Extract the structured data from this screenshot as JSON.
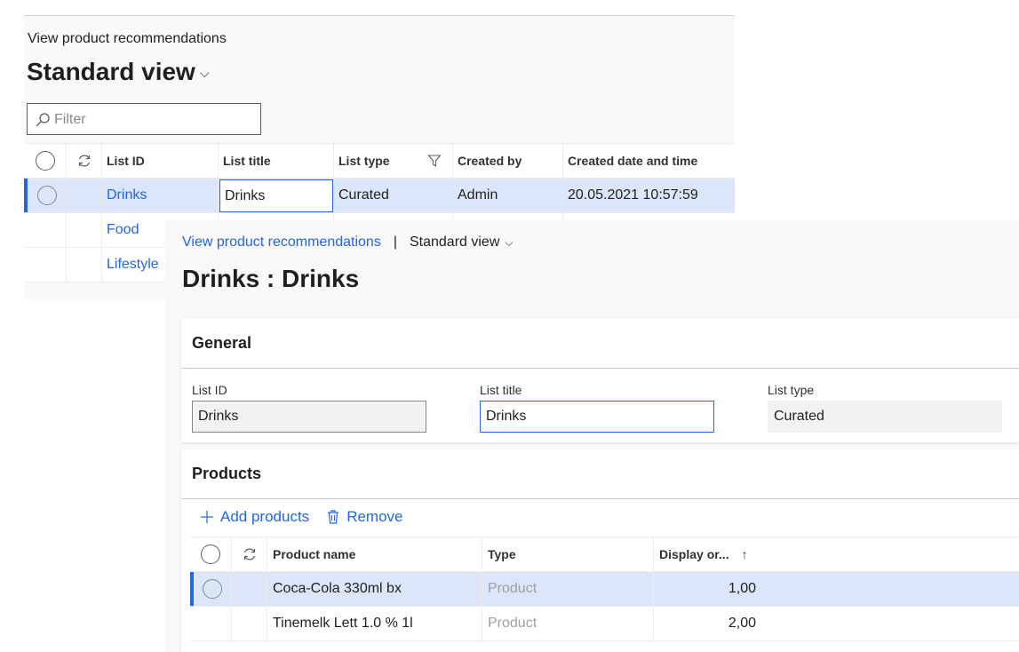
{
  "list_page": {
    "caption": "View product recommendations",
    "view_title": "Standard view",
    "filter_placeholder": "Filter",
    "columns": [
      "List ID",
      "List title",
      "List type",
      "Created by",
      "Created date and time"
    ],
    "rows": [
      {
        "id": "Drinks",
        "title": "Drinks",
        "type": "Curated",
        "created_by": "Admin",
        "created_at": "20.05.2021 10:57:59"
      },
      {
        "id": "Food"
      },
      {
        "id": "Lifestyle"
      }
    ]
  },
  "detail_page": {
    "breadcrumb_link": "View product recommendations",
    "breadcrumb_sep": "|",
    "breadcrumb_view": "Standard view",
    "title": "Drinks : Drinks",
    "general": {
      "header": "General",
      "list_id_label": "List ID",
      "list_id_value": "Drinks",
      "list_title_label": "List title",
      "list_title_value": "Drinks",
      "list_type_label": "List type",
      "list_type_value": "Curated"
    },
    "products": {
      "header": "Products",
      "add_label": "Add products",
      "remove_label": "Remove",
      "columns": [
        "Product name",
        "Type",
        "Display or..."
      ],
      "rows": [
        {
          "name": "Coca-Cola 330ml bx",
          "type": "Product",
          "order": "1,00"
        },
        {
          "name": "Tinemelk Lett 1.0 % 1l",
          "type": "Product",
          "order": "2,00"
        }
      ]
    }
  },
  "colors": {
    "accent": "#2266e3",
    "selected_row": "#dce6fa",
    "panel_bg": "#faf9f8"
  },
  "icons": [
    "search-icon",
    "refresh-icon",
    "filter-icon",
    "chevron-down-icon",
    "add-icon",
    "trash-icon",
    "sort-ascending-icon"
  ]
}
